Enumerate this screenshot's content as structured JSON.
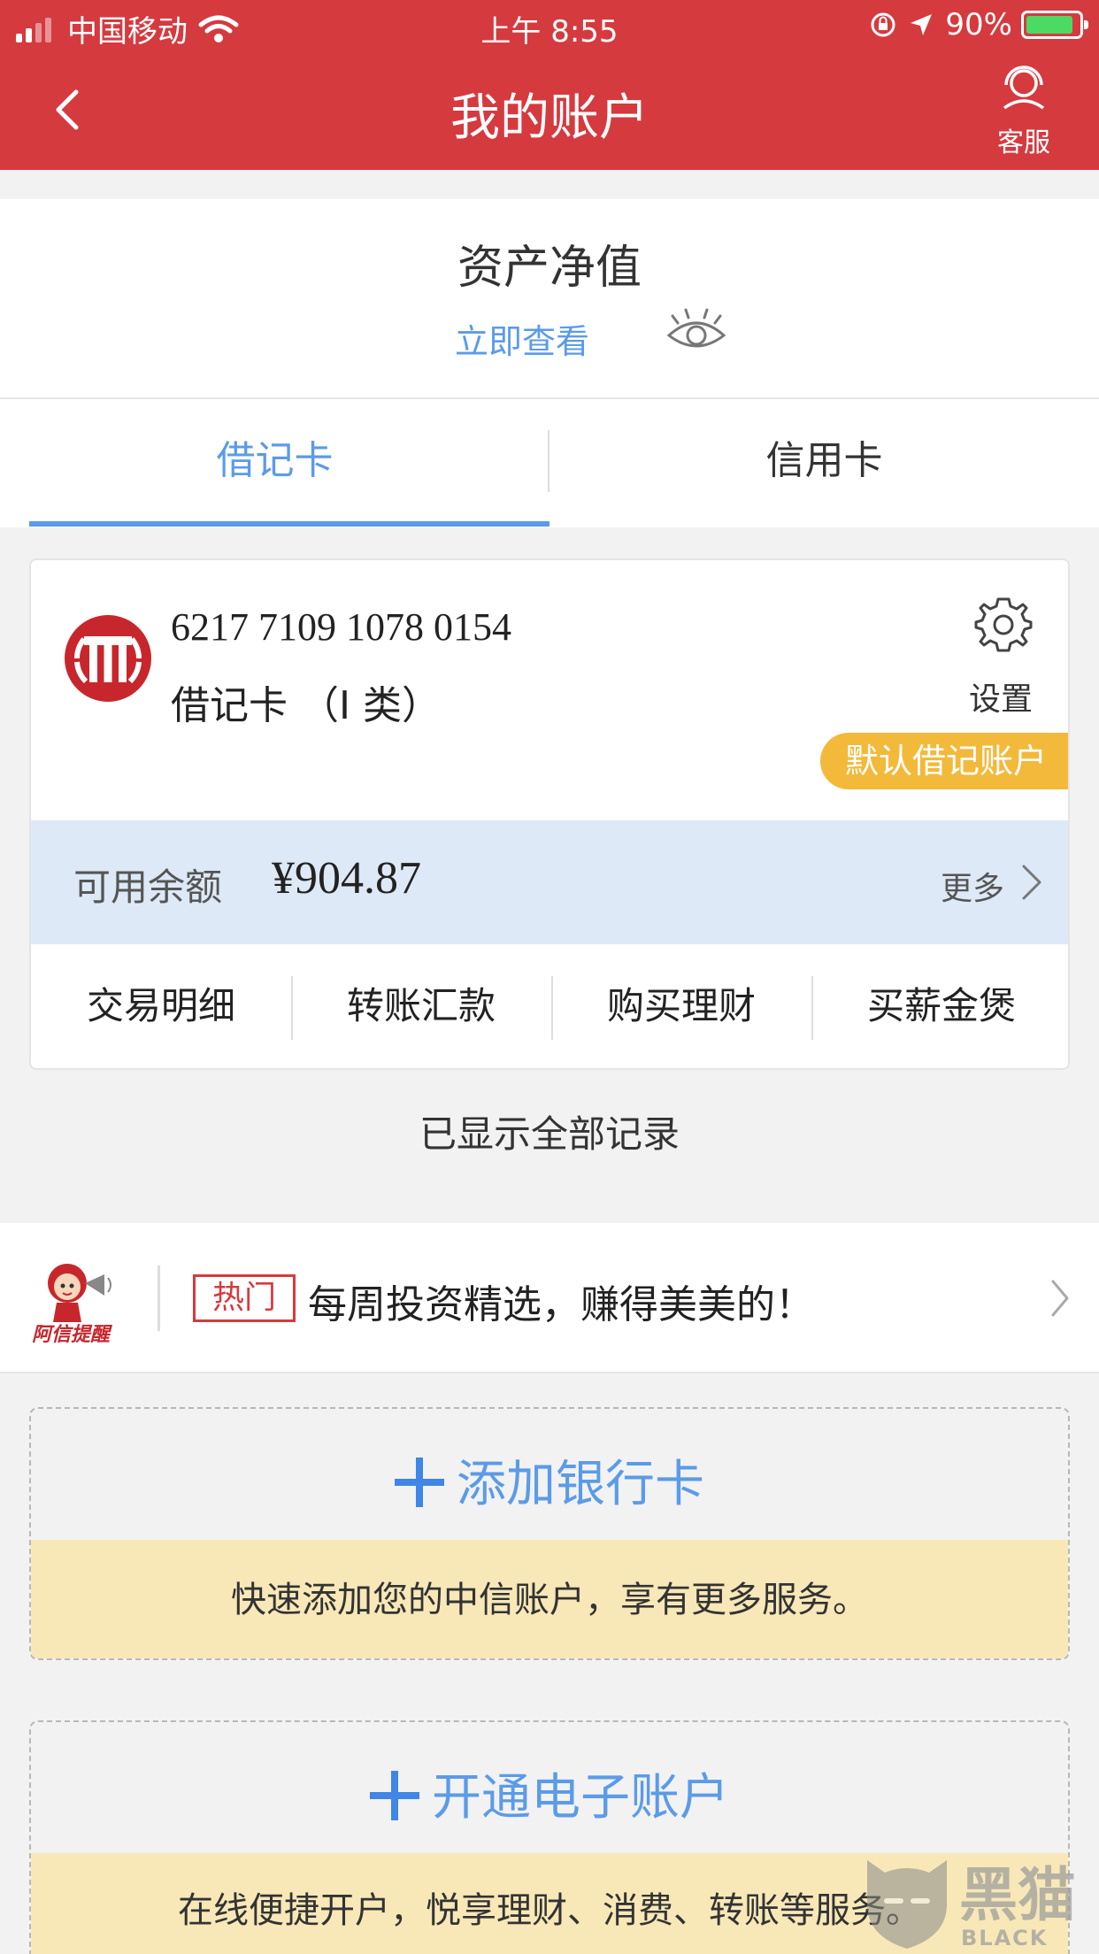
{
  "status_bar": {
    "carrier": "中国移动",
    "time": "上午 8:55",
    "battery": "90%"
  },
  "nav": {
    "title": "我的账户",
    "service_label": "客服"
  },
  "asset": {
    "title": "资产净值",
    "view_link": "立即查看"
  },
  "tabs": [
    {
      "label": "借记卡",
      "active": true
    },
    {
      "label": "信用卡",
      "active": false
    }
  ],
  "card": {
    "number": "6217 7109 1078 0154",
    "type": "借记卡 （I 类）",
    "settings_label": "设置",
    "default_badge": "默认借记账户",
    "balance_label": "可用余额",
    "balance_value": "¥904.87",
    "more_label": "更多",
    "actions": [
      "交易明细",
      "转账汇款",
      "购买理财",
      "买薪金煲"
    ]
  },
  "records_note": "已显示全部记录",
  "promo": {
    "mascot_caption": "阿信提醒",
    "tag": "热门",
    "text": "每周投资精选，赚得美美的！"
  },
  "add_card": {
    "title": "添加银行卡",
    "note": "快速添加您的中信账户，享有更多服务。"
  },
  "open_account": {
    "title": "开通电子账户",
    "note": "在线便捷开户，悦享理财、消费、转账等服务。"
  },
  "watermark": {
    "brand": "黑猫",
    "sub": "BLACK CAT"
  },
  "colors": {
    "brand_red": "#d53a3f",
    "accent_blue": "#5b9be8",
    "badge_yellow": "#f3b93a"
  }
}
